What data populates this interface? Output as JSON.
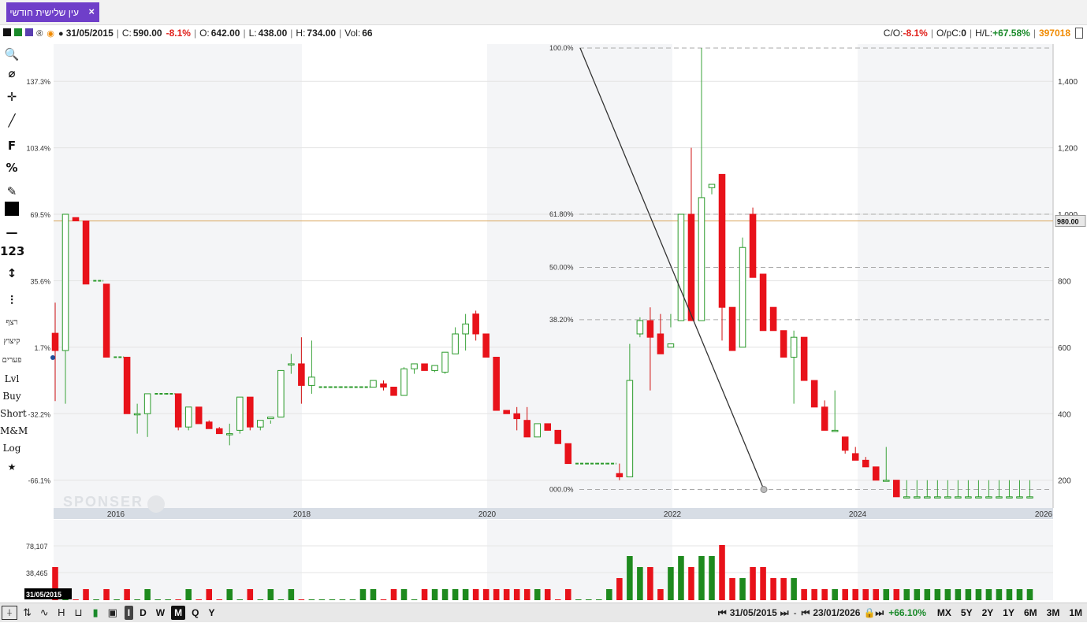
{
  "tab": {
    "title": "עין שלישית חודשי",
    "close": "×"
  },
  "info": {
    "date": "31/05/2015",
    "close_label": "C:",
    "close": "590.00",
    "close_change": "-8.1%",
    "open_label": "O:",
    "open": "642.00",
    "low_label": "L:",
    "low": "438.00",
    "high_label": "H:",
    "high": "734.00",
    "vol_label": "Vol:",
    "vol": "66",
    "co_label": "C/O:",
    "co": "-8.1%",
    "opc_label": "O/pC:",
    "opc": "0",
    "hl_label": "H/L:",
    "hl": "+67.58%",
    "id": "397018"
  },
  "tools": [
    "🔍",
    "⌀",
    "✛",
    "╱",
    "F",
    "%",
    "✎",
    "■",
    "—",
    "123",
    "↕",
    "⫶",
    "רצף",
    "קיצוץ",
    "פערים",
    "Lvl",
    "Buy",
    "Short",
    "M&M",
    "Log",
    "★"
  ],
  "price_label": "980.00",
  "volume_cursor_date": "31/05/2015",
  "volume_ticks": [
    "78,107",
    "38,465"
  ],
  "watermark": "SPONSER",
  "chart_data": {
    "type": "candlestick",
    "x_years": [
      "2016",
      "2018",
      "2020",
      "2022",
      "2024",
      "2026"
    ],
    "y_right_ticks": [
      1400,
      1200,
      1000,
      800,
      600,
      400,
      200
    ],
    "y_left_ticks": [
      "137.3%",
      "103.4%",
      "69.5%",
      "35.6%",
      "1.7%",
      "-32.2%",
      "-66.1%"
    ],
    "ylim": [
      140,
      1500
    ],
    "current_price": 980,
    "fibonacci": [
      {
        "label": "100.0%",
        "price": 1500
      },
      {
        "label": "61.80%",
        "price": 1000
      },
      {
        "label": "50.00%",
        "price": 840
      },
      {
        "label": "38.20%",
        "price": 683
      },
      {
        "label": "000.0%",
        "price": 172
      }
    ],
    "candles": [
      [
        642,
        734,
        438,
        590
      ],
      [
        590,
        1000,
        430,
        1000
      ],
      [
        990,
        990,
        990,
        980
      ],
      [
        980,
        980,
        800,
        790
      ],
      [
        800,
        800,
        800,
        800
      ],
      [
        790,
        790,
        570,
        570
      ],
      [
        570,
        570,
        570,
        570
      ],
      [
        570,
        570,
        400,
        400
      ],
      [
        400,
        430,
        340,
        400
      ],
      [
        400,
        460,
        330,
        460
      ],
      [
        460,
        460,
        460,
        460
      ],
      [
        460,
        460,
        460,
        460
      ],
      [
        460,
        460,
        350,
        360
      ],
      [
        360,
        420,
        350,
        420
      ],
      [
        420,
        420,
        370,
        370
      ],
      [
        375,
        380,
        355,
        355
      ],
      [
        355,
        360,
        340,
        340
      ],
      [
        340,
        370,
        305,
        340
      ],
      [
        350,
        450,
        340,
        450
      ],
      [
        450,
        450,
        350,
        360
      ],
      [
        360,
        380,
        350,
        380
      ],
      [
        385,
        380,
        370,
        390
      ],
      [
        390,
        530,
        390,
        530
      ],
      [
        550,
        580,
        520,
        550
      ],
      [
        550,
        630,
        430,
        485
      ],
      [
        485,
        620,
        460,
        510
      ],
      [
        480,
        480,
        480,
        480
      ],
      [
        480,
        480,
        480,
        480
      ],
      [
        480,
        480,
        480,
        480
      ],
      [
        480,
        480,
        480,
        480
      ],
      [
        480,
        480,
        480,
        480
      ],
      [
        480,
        500,
        480,
        500
      ],
      [
        490,
        500,
        470,
        480
      ],
      [
        480,
        480,
        455,
        455
      ],
      [
        455,
        540,
        455,
        535
      ],
      [
        535,
        550,
        520,
        550
      ],
      [
        550,
        550,
        530,
        530
      ],
      [
        530,
        545,
        525,
        545
      ],
      [
        525,
        580,
        520,
        585
      ],
      [
        580,
        660,
        585,
        640
      ],
      [
        640,
        700,
        590,
        670
      ],
      [
        700,
        710,
        620,
        640
      ],
      [
        640,
        640,
        570,
        570
      ],
      [
        570,
        570,
        410,
        410
      ],
      [
        410,
        410,
        400,
        400
      ],
      [
        400,
        420,
        350,
        385
      ],
      [
        380,
        420,
        330,
        330
      ],
      [
        330,
        360,
        330,
        370
      ],
      [
        370,
        370,
        350,
        350
      ],
      [
        350,
        350,
        310,
        310
      ],
      [
        310,
        310,
        250,
        250
      ],
      [
        250,
        250,
        250,
        250
      ],
      [
        250,
        250,
        250,
        250
      ],
      [
        250,
        250,
        250,
        250
      ],
      [
        250,
        250,
        250,
        250
      ],
      [
        220,
        250,
        200,
        210
      ],
      [
        210,
        610,
        210,
        500
      ],
      [
        640,
        690,
        630,
        680
      ],
      [
        680,
        720,
        470,
        630
      ],
      [
        640,
        700,
        600,
        580
      ],
      [
        600,
        700,
        660,
        610
      ],
      [
        680,
        800,
        680,
        1000
      ],
      [
        1000,
        1200,
        680,
        680
      ],
      [
        680,
        1500,
        680,
        1050
      ],
      [
        1080,
        1060,
        1090,
        1090
      ],
      [
        1120,
        1120,
        620,
        720
      ],
      [
        720,
        710,
        620,
        590
      ],
      [
        600,
        930,
        600,
        900
      ],
      [
        1000,
        1020,
        830,
        810
      ],
      [
        820,
        810,
        720,
        650
      ],
      [
        720,
        720,
        650,
        650
      ],
      [
        650,
        640,
        580,
        570
      ],
      [
        570,
        650,
        430,
        630
      ],
      [
        630,
        620,
        500,
        500
      ],
      [
        500,
        490,
        430,
        420
      ],
      [
        420,
        440,
        360,
        350
      ],
      [
        350,
        470,
        350,
        350
      ],
      [
        330,
        330,
        280,
        290
      ],
      [
        280,
        300,
        260,
        260
      ],
      [
        260,
        270,
        240,
        240
      ],
      [
        240,
        240,
        200,
        200
      ],
      [
        200,
        300,
        200,
        200
      ],
      [
        200,
        200,
        150,
        150
      ],
      [
        150,
        200,
        150,
        150
      ],
      [
        150,
        200,
        150,
        150
      ],
      [
        150,
        200,
        150,
        150
      ],
      [
        150,
        200,
        150,
        150
      ],
      [
        150,
        200,
        150,
        150
      ],
      [
        150,
        200,
        150,
        150
      ],
      [
        150,
        200,
        150,
        150
      ],
      [
        150,
        200,
        150,
        150
      ],
      [
        150,
        200,
        150,
        150
      ],
      [
        150,
        200,
        150,
        150
      ],
      [
        150,
        200,
        150,
        150
      ],
      [
        150,
        200,
        150,
        150
      ],
      [
        150,
        200,
        150,
        150
      ]
    ],
    "volumes": [
      3,
      1,
      0,
      1,
      0,
      1,
      0,
      1,
      0,
      1,
      0,
      0,
      0,
      1,
      0,
      1,
      0,
      1,
      0,
      1,
      0,
      1,
      0,
      1,
      0,
      0,
      0,
      0,
      0,
      0,
      1,
      1,
      0,
      1,
      1,
      0,
      1,
      1,
      1,
      1,
      1,
      1,
      1,
      1,
      1,
      1,
      1,
      1,
      1,
      0,
      1,
      0,
      0,
      0,
      1,
      2,
      4,
      3,
      3,
      1,
      3,
      4,
      3,
      4,
      4,
      5,
      2,
      2,
      3,
      3,
      2,
      2,
      2,
      1,
      1,
      1,
      1,
      1,
      1,
      1,
      1,
      1,
      1,
      1,
      1,
      1,
      1,
      1,
      1,
      1,
      1,
      1,
      1,
      1,
      1,
      1
    ]
  },
  "bottom": {
    "left_buttons": [
      "I",
      "D",
      "W",
      "M",
      "Q",
      "Y"
    ],
    "selected": "M",
    "from_date": "31/05/2015",
    "to_date": "23/01/2026",
    "change": "+66.10%",
    "ranges": [
      "MX",
      "5Y",
      "2Y",
      "1Y",
      "6M",
      "3M",
      "1M"
    ]
  }
}
